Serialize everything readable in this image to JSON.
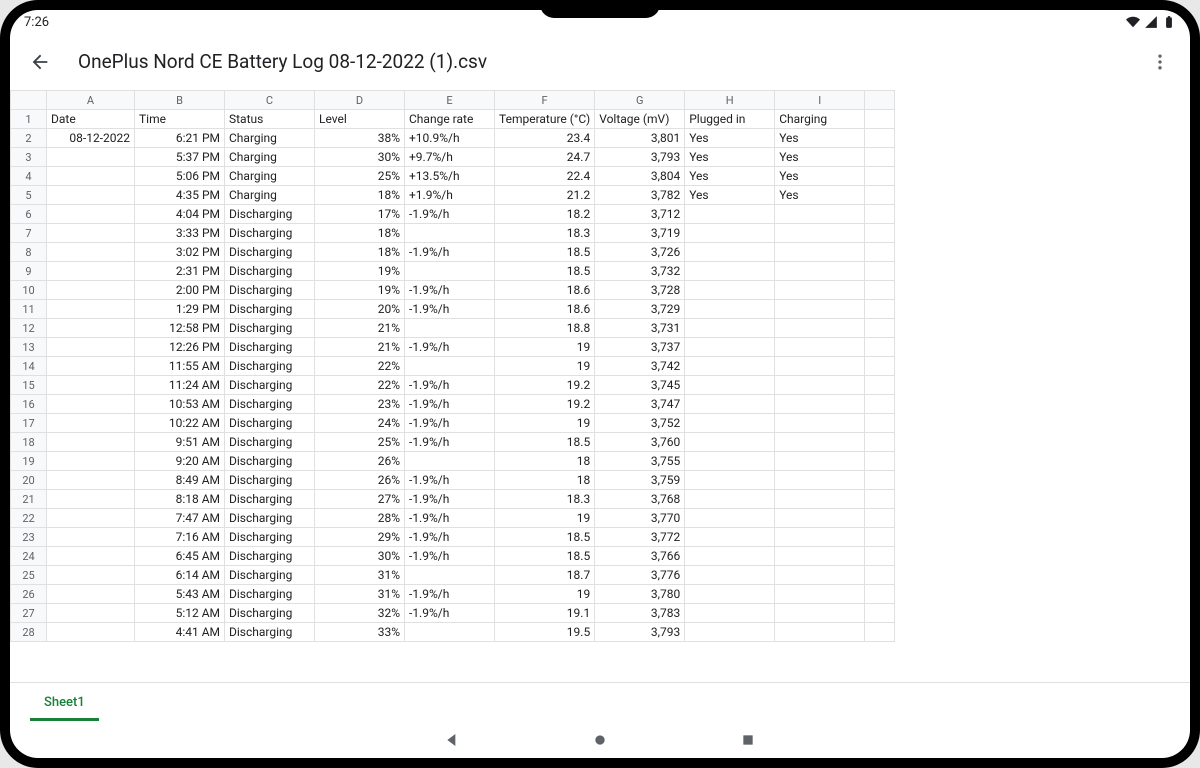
{
  "status": {
    "time": "7:26"
  },
  "header": {
    "title": "OnePlus Nord CE Battery Log 08-12-2022 (1).csv"
  },
  "sheet": {
    "columns": [
      "A",
      "B",
      "C",
      "D",
      "E",
      "F",
      "G",
      "H",
      "I"
    ],
    "headerRow": {
      "A": "Date",
      "B": "Time",
      "C": "Status",
      "D": "Level",
      "E": "Change rate",
      "F": "Temperature (°C)",
      "G": "Voltage (mV)",
      "H": "Plugged in",
      "I": "Charging"
    },
    "rows": [
      {
        "A": "08-12-2022",
        "B": "6:21 PM",
        "C": "Charging",
        "D": "38%",
        "E": "+10.9%/h",
        "F": "23.4",
        "G": "3,801",
        "H": "Yes",
        "I": "Yes"
      },
      {
        "A": "",
        "B": "5:37 PM",
        "C": "Charging",
        "D": "30%",
        "E": "+9.7%/h",
        "F": "24.7",
        "G": "3,793",
        "H": "Yes",
        "I": "Yes"
      },
      {
        "A": "",
        "B": "5:06 PM",
        "C": "Charging",
        "D": "25%",
        "E": "+13.5%/h",
        "F": "22.4",
        "G": "3,804",
        "H": "Yes",
        "I": "Yes"
      },
      {
        "A": "",
        "B": "4:35 PM",
        "C": "Charging",
        "D": "18%",
        "E": "+1.9%/h",
        "F": "21.2",
        "G": "3,782",
        "H": "Yes",
        "I": "Yes"
      },
      {
        "A": "",
        "B": "4:04 PM",
        "C": "Discharging",
        "D": "17%",
        "E": "-1.9%/h",
        "F": "18.2",
        "G": "3,712",
        "H": "",
        "I": ""
      },
      {
        "A": "",
        "B": "3:33 PM",
        "C": "Discharging",
        "D": "18%",
        "E": "",
        "F": "18.3",
        "G": "3,719",
        "H": "",
        "I": ""
      },
      {
        "A": "",
        "B": "3:02 PM",
        "C": "Discharging",
        "D": "18%",
        "E": "-1.9%/h",
        "F": "18.5",
        "G": "3,726",
        "H": "",
        "I": ""
      },
      {
        "A": "",
        "B": "2:31 PM",
        "C": "Discharging",
        "D": "19%",
        "E": "",
        "F": "18.5",
        "G": "3,732",
        "H": "",
        "I": ""
      },
      {
        "A": "",
        "B": "2:00 PM",
        "C": "Discharging",
        "D": "19%",
        "E": "-1.9%/h",
        "F": "18.6",
        "G": "3,728",
        "H": "",
        "I": ""
      },
      {
        "A": "",
        "B": "1:29 PM",
        "C": "Discharging",
        "D": "20%",
        "E": "-1.9%/h",
        "F": "18.6",
        "G": "3,729",
        "H": "",
        "I": ""
      },
      {
        "A": "",
        "B": "12:58 PM",
        "C": "Discharging",
        "D": "21%",
        "E": "",
        "F": "18.8",
        "G": "3,731",
        "H": "",
        "I": ""
      },
      {
        "A": "",
        "B": "12:26 PM",
        "C": "Discharging",
        "D": "21%",
        "E": "-1.9%/h",
        "F": "19",
        "G": "3,737",
        "H": "",
        "I": ""
      },
      {
        "A": "",
        "B": "11:55 AM",
        "C": "Discharging",
        "D": "22%",
        "E": "",
        "F": "19",
        "G": "3,742",
        "H": "",
        "I": ""
      },
      {
        "A": "",
        "B": "11:24 AM",
        "C": "Discharging",
        "D": "22%",
        "E": "-1.9%/h",
        "F": "19.2",
        "G": "3,745",
        "H": "",
        "I": ""
      },
      {
        "A": "",
        "B": "10:53 AM",
        "C": "Discharging",
        "D": "23%",
        "E": "-1.9%/h",
        "F": "19.2",
        "G": "3,747",
        "H": "",
        "I": ""
      },
      {
        "A": "",
        "B": "10:22 AM",
        "C": "Discharging",
        "D": "24%",
        "E": "-1.9%/h",
        "F": "19",
        "G": "3,752",
        "H": "",
        "I": ""
      },
      {
        "A": "",
        "B": "9:51 AM",
        "C": "Discharging",
        "D": "25%",
        "E": "-1.9%/h",
        "F": "18.5",
        "G": "3,760",
        "H": "",
        "I": ""
      },
      {
        "A": "",
        "B": "9:20 AM",
        "C": "Discharging",
        "D": "26%",
        "E": "",
        "F": "18",
        "G": "3,755",
        "H": "",
        "I": ""
      },
      {
        "A": "",
        "B": "8:49 AM",
        "C": "Discharging",
        "D": "26%",
        "E": "-1.9%/h",
        "F": "18",
        "G": "3,759",
        "H": "",
        "I": ""
      },
      {
        "A": "",
        "B": "8:18 AM",
        "C": "Discharging",
        "D": "27%",
        "E": "-1.9%/h",
        "F": "18.3",
        "G": "3,768",
        "H": "",
        "I": ""
      },
      {
        "A": "",
        "B": "7:47 AM",
        "C": "Discharging",
        "D": "28%",
        "E": "-1.9%/h",
        "F": "19",
        "G": "3,770",
        "H": "",
        "I": ""
      },
      {
        "A": "",
        "B": "7:16 AM",
        "C": "Discharging",
        "D": "29%",
        "E": "-1.9%/h",
        "F": "18.5",
        "G": "3,772",
        "H": "",
        "I": ""
      },
      {
        "A": "",
        "B": "6:45 AM",
        "C": "Discharging",
        "D": "30%",
        "E": "-1.9%/h",
        "F": "18.5",
        "G": "3,766",
        "H": "",
        "I": ""
      },
      {
        "A": "",
        "B": "6:14 AM",
        "C": "Discharging",
        "D": "31%",
        "E": "",
        "F": "18.7",
        "G": "3,776",
        "H": "",
        "I": ""
      },
      {
        "A": "",
        "B": "5:43 AM",
        "C": "Discharging",
        "D": "31%",
        "E": "-1.9%/h",
        "F": "19",
        "G": "3,780",
        "H": "",
        "I": ""
      },
      {
        "A": "",
        "B": "5:12 AM",
        "C": "Discharging",
        "D": "32%",
        "E": "-1.9%/h",
        "F": "19.1",
        "G": "3,783",
        "H": "",
        "I": ""
      },
      {
        "A": "",
        "B": "4:41 AM",
        "C": "Discharging",
        "D": "33%",
        "E": "",
        "F": "19.5",
        "G": "3,793",
        "H": "",
        "I": ""
      }
    ],
    "alignment": {
      "A": "r",
      "B": "r",
      "C": "l",
      "D": "r",
      "E": "l",
      "F": "r",
      "G": "r",
      "H": "l",
      "I": "l"
    }
  },
  "tabs": {
    "active": "Sheet1"
  }
}
